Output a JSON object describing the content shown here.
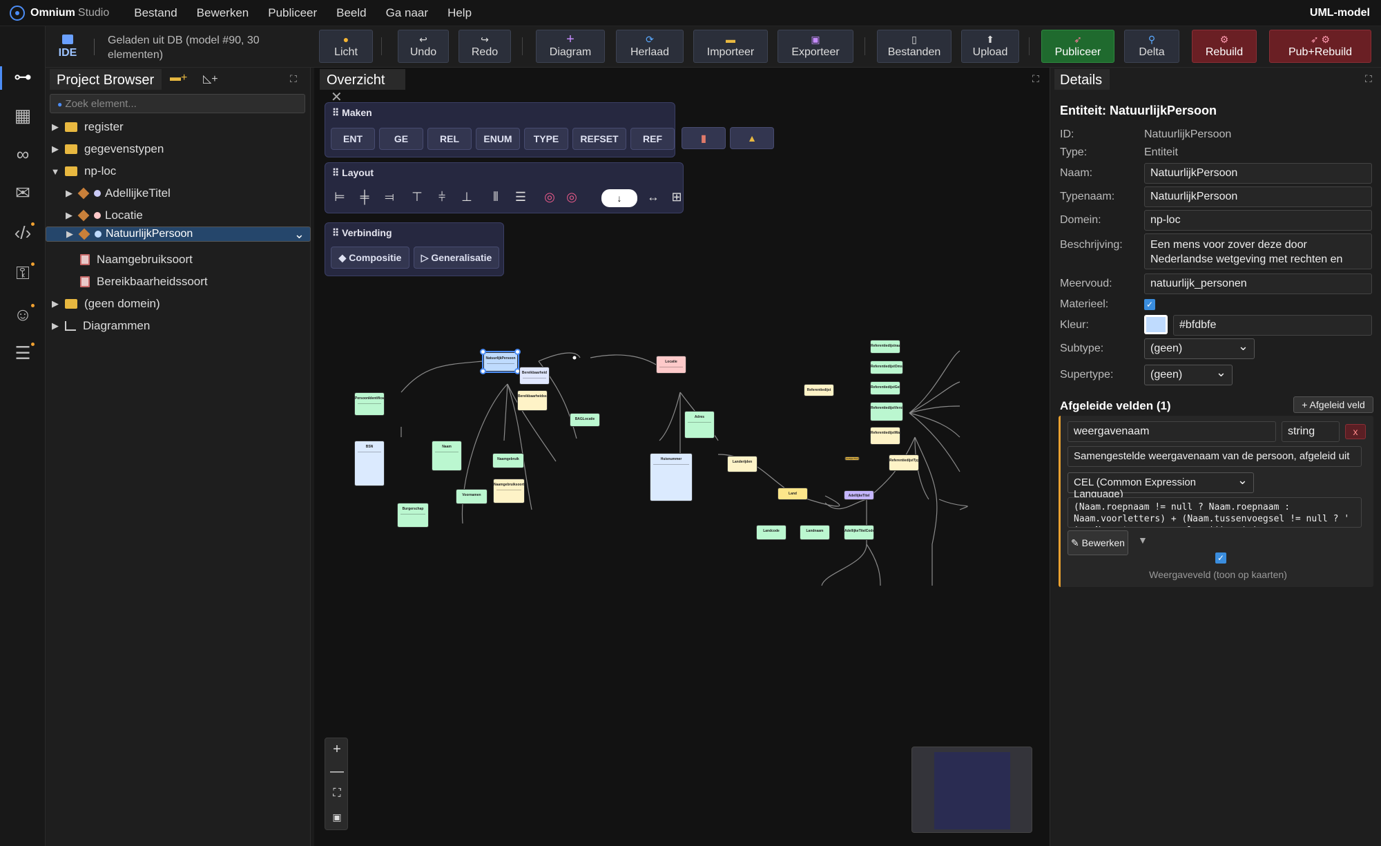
{
  "menubar": {
    "brand": "Omnium",
    "brand_sub": "Studio",
    "items": [
      "Bestand",
      "Bewerken",
      "Publiceer",
      "Beeld",
      "Ga naar",
      "Help"
    ],
    "model_label": "UML-model"
  },
  "toolbar": {
    "ide_label": "IDE",
    "db_info": "Geladen uit DB (model #90, 30 elementen)",
    "buttons": [
      {
        "label": "Licht",
        "glyph": "●"
      },
      {
        "label": "Undo",
        "glyph": "↩"
      },
      {
        "label": "Redo",
        "glyph": "↪"
      },
      {
        "label": "Diagram",
        "glyph": "+"
      },
      {
        "label": "Herlaad",
        "glyph": "⟳"
      },
      {
        "label": "Importeer",
        "glyph": "▬"
      },
      {
        "label": "Exporteer",
        "glyph": "▣"
      },
      {
        "label": "Bestanden",
        "glyph": "▯"
      },
      {
        "label": "Upload",
        "glyph": "⬆"
      },
      {
        "label": "Publiceer",
        "glyph": "➶"
      },
      {
        "label": "Delta",
        "glyph": "⚲"
      },
      {
        "label": "Rebuild",
        "glyph": "⚙"
      },
      {
        "label": "Pub+Rebuild",
        "glyph": "➶ ⚙"
      }
    ]
  },
  "project_browser": {
    "tab": "Project Browser",
    "search_placeholder": "Zoek element...",
    "items": [
      "register",
      "gegevenstypen",
      "np-loc",
      "AdellijkeTitel",
      "Locatie",
      "NatuurlijkPersoon",
      "Naamgebruiksoort",
      "Bereikbaarheidssoort",
      "(geen domein)",
      "Diagrammen"
    ]
  },
  "canvas": {
    "tab": "Overzicht",
    "maken": {
      "title": "Maken",
      "buttons": [
        "ENT",
        "GE",
        "REL",
        "ENUM",
        "TYPE",
        "REFSET",
        "REF"
      ]
    },
    "layout": {
      "title": "Layout",
      "select_value": "↓"
    },
    "verbinding": {
      "title": "Verbinding",
      "buttons": [
        "Compositie",
        "Generalisatie"
      ]
    },
    "nodes": [
      "NatuurlijkPersoon",
      "PersoonIdentificatie",
      "BSN",
      "Naam",
      "Naamgebruik",
      "Naamgebruiksoort",
      "Voornamen",
      "Burgerschap",
      "Bereikbaarheid",
      "Bereikbaarheidssoort",
      "Locatie",
      "BAGLocatie",
      "Adres",
      "Huisnummer",
      "Landerijden",
      "Land",
      "Landcode",
      "Landnaam",
      "Referentiedijst",
      "Referentiedijstnaam",
      "ReferentiedijstOmschrijving",
      "ReferentiedijstGeldigheid",
      "ReferentiedijstVersie",
      "ReferentiedijstWaarde",
      "ReferentiedijstType",
      "AdellijkeTitel",
      "AdellijkeTitelCode",
      "AdellijkeTitels"
    ]
  },
  "details": {
    "tab": "Details",
    "title": "Entiteit: NatuurlijkPersoon",
    "fields": {
      "id_label": "ID:",
      "id": "NatuurlijkPersoon",
      "type_label": "Type:",
      "type": "Entiteit",
      "naam_label": "Naam:",
      "naam": "NatuurlijkPersoon",
      "typenaam_label": "Typenaam:",
      "typenaam": "NatuurlijkPersoon",
      "domein_label": "Domein:",
      "domein": "np-loc",
      "beschrijving_label": "Beschrijving:",
      "beschrijving": "Een mens voor zover deze door Nederlandse wetgeving met rechten en plichten wordt",
      "meervoud_label": "Meervoud:",
      "meervoud": "natuurlijk_personen",
      "materieel_label": "Materieel:",
      "materieel": true,
      "kleur_label": "Kleur:",
      "kleur": "#bfdbfe",
      "subtype_label": "Subtype:",
      "subtype": "(geen)",
      "supertype_label": "Supertype:",
      "supertype": "(geen)"
    },
    "derived": {
      "title": "Afgeleide velden (1)",
      "add_button": "+ Afgeleid veld",
      "name": "weergavenaam",
      "type": "string",
      "remove": "x",
      "description": "Samengestelde weergavenaam van de persoon, afgeleid uit",
      "language": "CEL (Common Expression Language)",
      "expression": "(Naam.roepnaam != null ? Naam.roepnaam : Naam.voorletters) + (Naam.tussenvoegsel != null ? ' ' + Naam.tussenvoegsel : '') + ' ' + Naam.geslachtsnaam",
      "edit_button": "Bewerken",
      "display_label": "Weergaveveld (toon op kaarten)",
      "display_checked": true
    }
  }
}
